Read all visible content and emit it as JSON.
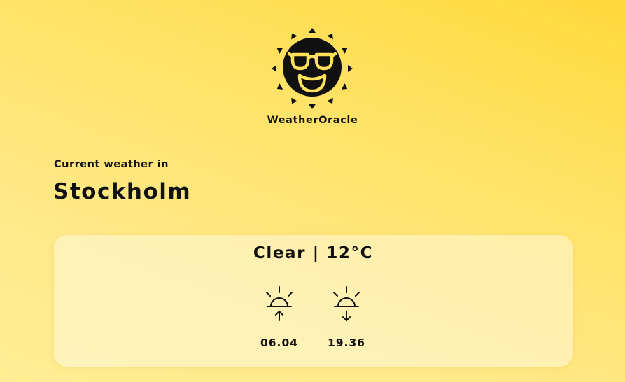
{
  "app": {
    "logo_icon": "sun-with-sunglasses-icon",
    "name": "WeatherOracle"
  },
  "location": {
    "label": "Current weather in",
    "city": "Stockholm"
  },
  "weather": {
    "summary": "Clear | 12°C",
    "sunrise": {
      "icon": "sunrise-icon",
      "time": "06.04"
    },
    "sunset": {
      "icon": "sunset-icon",
      "time": "19.36"
    }
  },
  "colors": {
    "background_top_right": "#ffd93a",
    "background_bottom_left": "#ffed95",
    "card": "#fff6d6",
    "text": "#111111"
  }
}
